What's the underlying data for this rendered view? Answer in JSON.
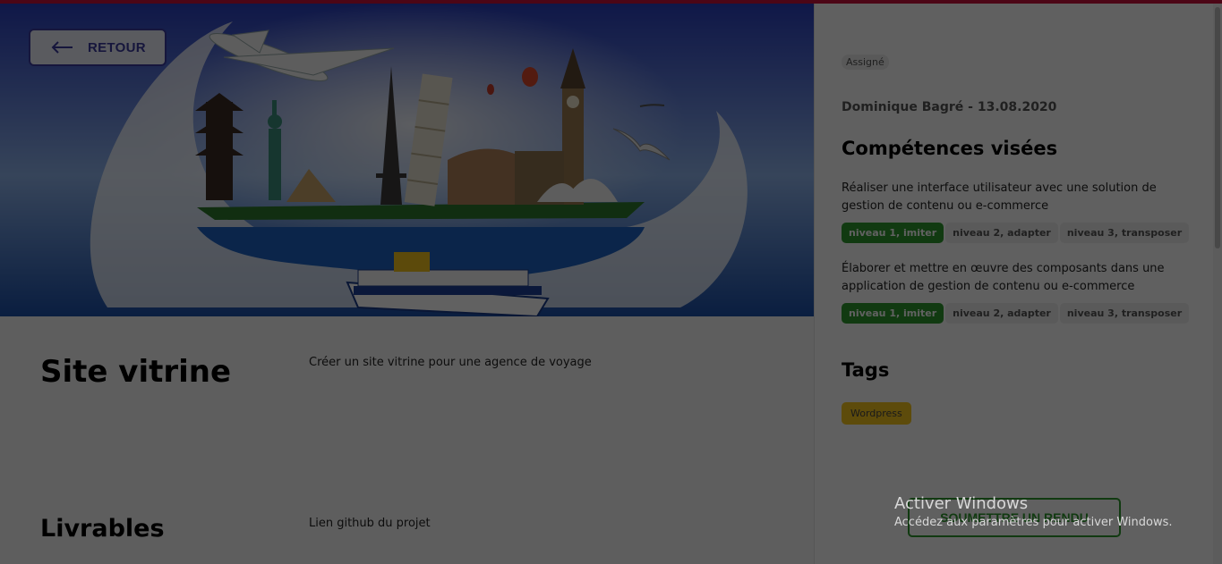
{
  "hero": {
    "back_label": "RETOUR"
  },
  "main": {
    "title": "Site vitrine",
    "description": "Créer un site vitrine pour une agence de voyage",
    "deliverables_title": "Livrables",
    "deliverables_text": "Lien github du projet"
  },
  "sidebar": {
    "status": "Assigné",
    "meta": "Dominique Bagré - 13.08.2020",
    "skills_title": "Compétences visées",
    "skills": [
      {
        "text": "Réaliser une interface utilisateur avec une solution de gestion de contenu ou e-commerce",
        "levels": [
          "niveau 1, imiter",
          "niveau 2, adapter",
          "niveau 3, transposer"
        ],
        "active_level": 0
      },
      {
        "text": "Élaborer et mettre en œuvre des composants dans une application de gestion de contenu ou e-commerce",
        "levels": [
          "niveau 1, imiter",
          "niveau 2, adapter",
          "niveau 3, transposer"
        ],
        "active_level": 0
      }
    ],
    "tags_title": "Tags",
    "tags": [
      "Wordpress"
    ],
    "submit_label": "SOUMETTRE UN RENDU"
  },
  "os_watermark": {
    "line1": "Activer Windows",
    "line2": "Accédez aux paramètres pour activer Windows."
  },
  "colors": {
    "accent_top": "#c8103a",
    "primary": "#3c3a9e",
    "success": "#2d9a2d",
    "tag": "#f5c41e"
  }
}
